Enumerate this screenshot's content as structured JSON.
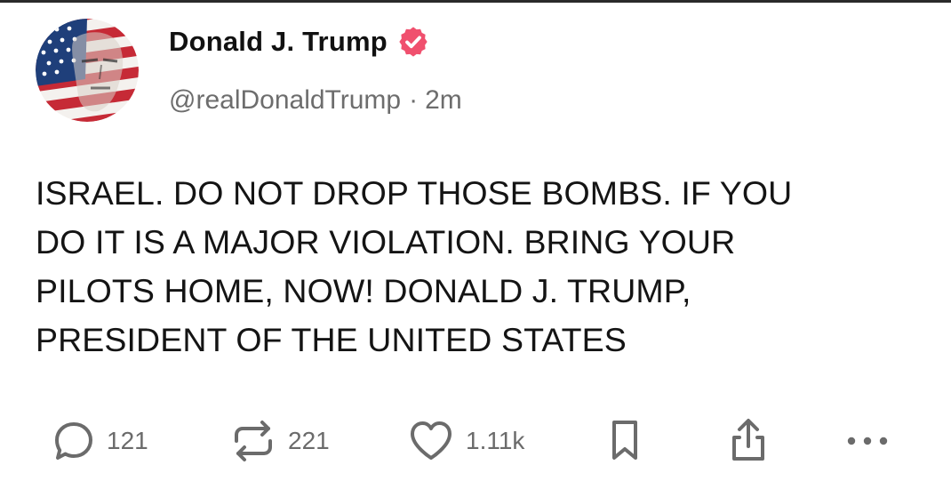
{
  "post": {
    "author": {
      "display_name": "Donald J. Trump",
      "handle": "@realDonaldTrump",
      "verified": true,
      "verified_color": "#f0506e",
      "avatar_icon": "flag-portrait-avatar"
    },
    "separator": "·",
    "timestamp": "2m",
    "text_lines": [
      "ISRAEL. DO NOT DROP THOSE BOMBS. IF YOU",
      "DO IT IS A MAJOR VIOLATION. BRING YOUR",
      "PILOTS HOME, NOW!  DONALD J. TRUMP,",
      "PRESIDENT OF THE UNITED STATES"
    ]
  },
  "actions": {
    "reply": {
      "icon": "reply-bubble-icon",
      "count": "121"
    },
    "repost": {
      "icon": "repost-icon",
      "count": "221"
    },
    "like": {
      "icon": "heart-icon",
      "count": "1.11k"
    },
    "bookmark": {
      "icon": "bookmark-icon"
    },
    "share": {
      "icon": "share-icon"
    },
    "more": {
      "icon": "more-dots-icon"
    }
  },
  "colors": {
    "text": "#141414",
    "secondary": "#6d6d6d",
    "icon": "#6b6b6b",
    "background": "#ffffff"
  }
}
